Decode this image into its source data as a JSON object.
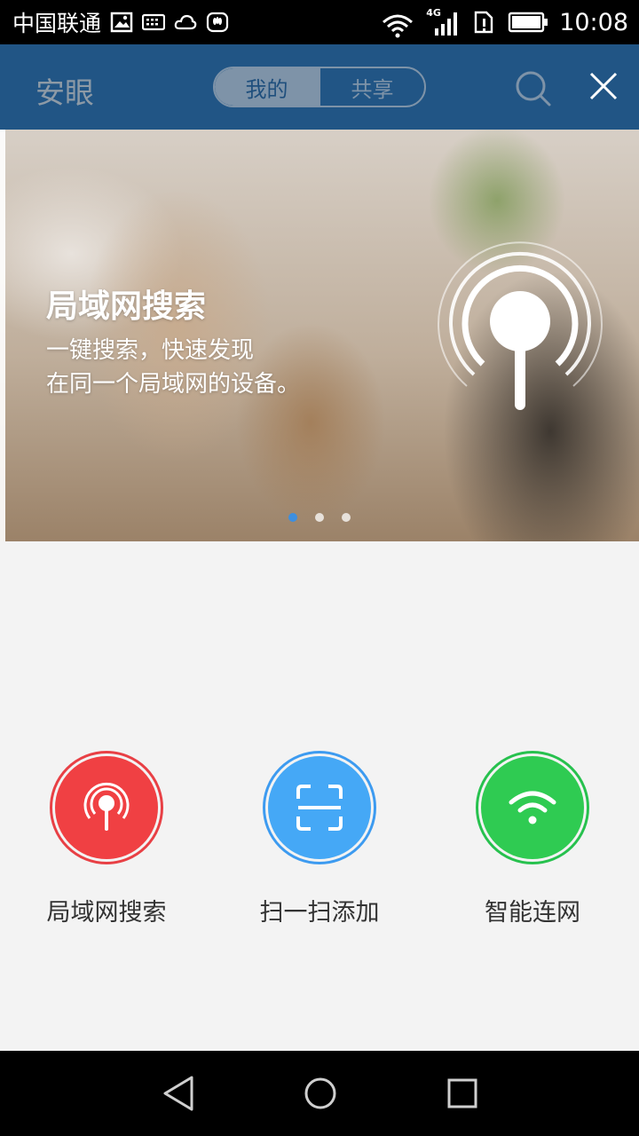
{
  "status_bar": {
    "carrier": "中国联通",
    "network_type": "4G",
    "time": "10:08",
    "icons": [
      "image-icon",
      "keyboard-icon",
      "cloud-icon",
      "huawei-icon",
      "wifi-icon",
      "signal-icon",
      "sim-alert-icon",
      "battery-icon"
    ]
  },
  "header": {
    "title": "安眼",
    "tabs": [
      {
        "label": "我的",
        "active": true
      },
      {
        "label": "共享",
        "active": false
      }
    ],
    "actions": [
      "search-icon",
      "close-icon"
    ]
  },
  "banner": {
    "title": "局域网搜索",
    "subtitle_line1": "一键搜索，快速发现",
    "subtitle_line2": "在同一个局域网的设备。",
    "icon": "broadcast-icon",
    "pages": 3,
    "active_page": 1,
    "accent_color": "#3d8fe0"
  },
  "actions": [
    {
      "label": "局域网搜索",
      "icon": "broadcast-icon",
      "color": "#f04043"
    },
    {
      "label": "扫一扫添加",
      "icon": "scan-icon",
      "color": "#45a8f6"
    },
    {
      "label": "智能连网",
      "icon": "wifi-icon",
      "color": "#2fcb52"
    }
  ],
  "colors": {
    "app_bar": "#215585",
    "background": "#f3f3f3"
  },
  "nav_bar": {
    "buttons": [
      "back-icon",
      "home-icon",
      "recents-icon"
    ]
  }
}
